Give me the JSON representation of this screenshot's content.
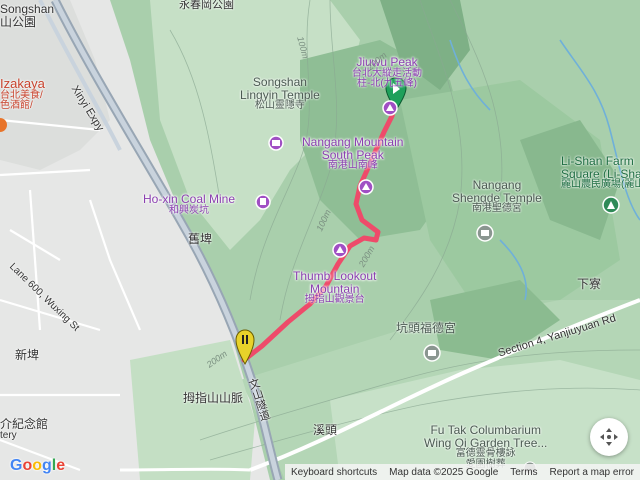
{
  "peak": {
    "name_en": "Jiuwu Peak",
    "name_zh_line1": "台北大縱走活動",
    "name_zh_line2": "柱-北(九五峰)"
  },
  "pois": {
    "lingyin": {
      "en_line1": "Songshan",
      "en_line2": "Lingyin Temple",
      "zh": "松山靈隱寺"
    },
    "nangang_south": {
      "en_line1": "Nangang Mountain",
      "en_line2": "South Peak",
      "zh": "南港山南峰"
    },
    "hoxin": {
      "en": "Ho-xin Coal Mine",
      "zh": "和興炭坑"
    },
    "thumb": {
      "en_line1": "Thumb Lookout",
      "en_line2": "Mountain",
      "zh": "拇指山觀景台"
    },
    "shengde": {
      "en_line1": "Nangang",
      "en_line2": "Shengde Temple",
      "zh": "南港聖德宮"
    },
    "lishan": {
      "en_line1": "Li-Shan Farm",
      "en_line2": "Square (Li-Shan",
      "zh": "麗山農民廣場(麗山"
    },
    "futak": {
      "en_line1": "Fu Tak Columbarium",
      "en_line2": "Wing Oi Garden Tree...",
      "zh_line1": "富德靈骨樓詠",
      "zh_line2": "愛園樹葬"
    },
    "kengtou": {
      "zh": "坑頭福德宮"
    }
  },
  "places": {
    "songshan_park": "Songshan",
    "songshan_park_zh": "山公園",
    "yongchun_park_zh": "永春岡公園",
    "izakaya": "Izakaya",
    "izakaya_zh1": "台北美食/",
    "izakaya_zh2": "色酒館/",
    "jiupi": "舊埤",
    "xinpi": "新埤",
    "muzhi_ridge": "拇指山山脈",
    "xitou": "溪頭",
    "xialiao": "下寮",
    "memorial": "介紀念館",
    "memorial_sub": "tery"
  },
  "roads": {
    "xinyi_expy": "Xinyi Expy",
    "lane600": "Lane 600, Wuxing St",
    "yanjiuyuan": "Section 4, Yanjiuyuan Rd",
    "wenshan_tunnel": "文山隧道"
  },
  "contours": [
    "100m",
    "200m",
    "100m",
    "200m",
    "200m"
  ],
  "footer": {
    "shortcuts": "Keyboard shortcuts",
    "mapdata": "Map data ©2025 Google",
    "terms": "Terms",
    "report": "Report a map error"
  },
  "logo": "Google",
  "colors": {
    "route": "#ee4b6a",
    "poi": "#8b3fb0",
    "start_pin": "#e8d22a",
    "end_pin": "#1ea05a"
  }
}
